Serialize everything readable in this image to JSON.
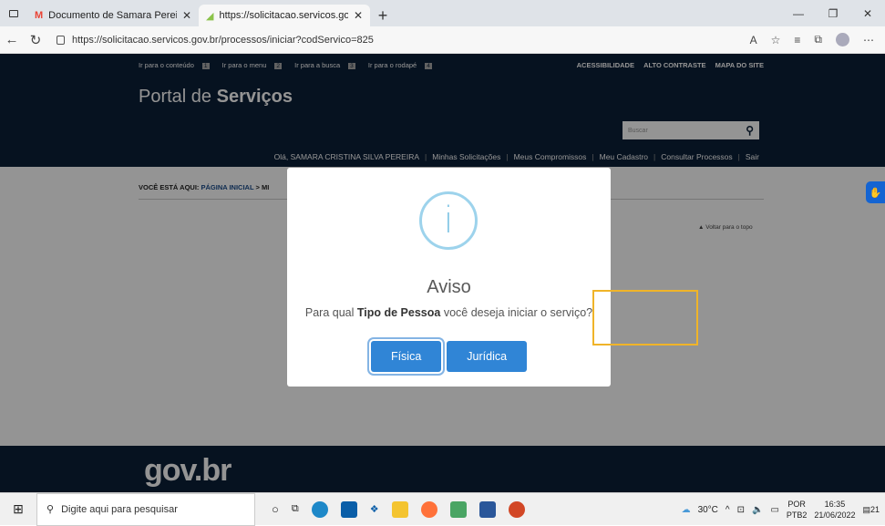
{
  "browser": {
    "tabs": [
      {
        "title": "Documento de Samara Pereira - ",
        "icon_color": "#ea4335"
      },
      {
        "title": "https://solicitacao.servicos.gov.b",
        "icon_color": "#8bc34a"
      }
    ],
    "url": "https://solicitacao.servicos.gov.br/processos/iniciar?codServico=825"
  },
  "header": {
    "skip_links": [
      {
        "label": "Ir para o conteúdo",
        "num": "1"
      },
      {
        "label": "Ir para o menu",
        "num": "2"
      },
      {
        "label": "Ir para a busca",
        "num": "3"
      },
      {
        "label": "Ir para o rodapé",
        "num": "4"
      }
    ],
    "accessibility": "ACESSIBILIDADE",
    "contrast": "ALTO CONTRASTE",
    "sitemap": "MAPA DO SITE",
    "portal_prefix": "Portal de ",
    "portal_bold": "Serviços",
    "search_placeholder": "Buscar",
    "greeting": "Olá, SAMARA CRISTINA SILVA PEREIRA",
    "nav": [
      "Minhas Solicitações",
      "Meus Compromissos",
      "Meu Cadastro",
      "Consultar Processos",
      "Sair"
    ]
  },
  "breadcrumb": {
    "prefix": "VOCÊ ESTÁ AQUI:",
    "home": "PÁGINA INICIAL",
    "sep": ">",
    "current": "MI"
  },
  "back_to_top": "▲ Voltar para o topo",
  "footer": {
    "logo": "gov.br"
  },
  "modal": {
    "icon": "i",
    "title": "Aviso",
    "text_before": "Para qual ",
    "text_bold": "Tipo de Pessoa",
    "text_after": " você deseja iniciar o serviço?",
    "buttons": [
      "Física",
      "Jurídica"
    ]
  },
  "taskbar": {
    "search_placeholder": "Digite aqui para pesquisar",
    "weather": "30°C",
    "lang1": "POR",
    "lang2": "PTB2",
    "time": "16:35",
    "date": "21/06/2022",
    "notif": "21"
  }
}
